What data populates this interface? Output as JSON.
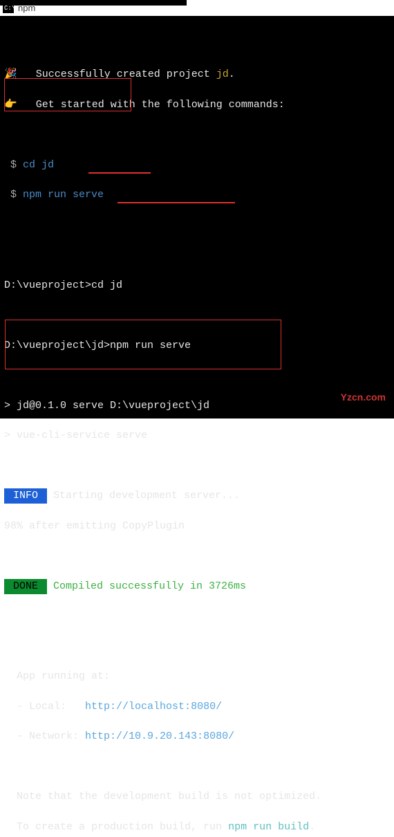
{
  "window": {
    "icon_text": "C:\\",
    "title": "npm"
  },
  "lines": {
    "created_prefix": "   Successfully created project ",
    "project_name": "jd",
    "created_suffix": ".",
    "getstarted": "   Get started with the following commands:",
    "cmd1_prompt": " $ ",
    "cmd1": "cd jd",
    "cmd2_prompt": " $ ",
    "cmd2": "npm run serve",
    "prompt1_path": "D:\\vueproject>",
    "prompt1_cmd": "cd jd",
    "prompt2_path": "D:\\vueproject\\jd>",
    "prompt2_cmd": "npm run serve",
    "serve1": "> jd@0.1.0 serve D:\\vueproject\\jd",
    "serve2": "> vue-cli-service serve",
    "info_label": " INFO ",
    "info_text": " Starting development server...",
    "progress": "98% after emitting CopyPlugin",
    "done_label": " DONE ",
    "done_text": " Compiled successfully in 3726ms",
    "app_running": "  App running at:",
    "local_label": "  - Local:   ",
    "local_url_a": "http://localhost:",
    "local_port": "8080",
    "local_url_b": "/",
    "network_label": "  - Network: ",
    "network_url_a": "http://10.9.20.143:",
    "network_port": "8080",
    "network_url_b": "/",
    "note1": "  Note that the development build is not optimized.",
    "note2a": "  To create a production build, run ",
    "note2b": "npm run build",
    "note2c": "."
  },
  "watermark": "Yzcn.com"
}
